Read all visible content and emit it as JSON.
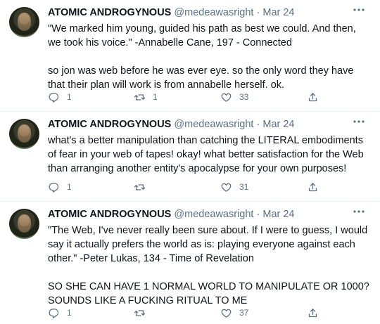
{
  "tweets": [
    {
      "name": "ATOMIC ANDROGYNOUS",
      "handle": "@medeawasright",
      "separator": "·",
      "date": "Mar 24",
      "text": "\"We marked him young, guided his path as best we could. And then, we took his voice.\" -Annabelle Cane, 197 - Connected\n\nso jon was web before he was ever eye. so the only word they have that their plan will work is from annabelle herself. ok.",
      "reply_count": "1",
      "retweet_count": "1",
      "like_count": "33"
    },
    {
      "name": "ATOMIC ANDROGYNOUS",
      "handle": "@medeawasright",
      "separator": "·",
      "date": "Mar 24",
      "text": "what's a better manipulation than catching the LITERAL embodiments of fear in your web of tapes! okay! what better satisfaction for the Web than arranging another entity's apocalypse for your own purposes!",
      "reply_count": "1",
      "retweet_count": "",
      "like_count": "31"
    },
    {
      "name": "ATOMIC ANDROGYNOUS",
      "handle": "@medeawasright",
      "separator": "·",
      "date": "Mar 24",
      "text": "\"The Web, I've never really been sure about. If I were to guess, I would say it actually prefers the world as is: playing everyone against each other.\" -Peter Lukas, 134 - Time of Revelation\n\nSO SHE CAN HAVE 1 NORMAL WORLD TO MANIPULATE OR 1000? SOUNDS LIKE A FUCKING RITUAL TO ME",
      "reply_count": "1",
      "retweet_count": "",
      "like_count": "37"
    }
  ],
  "icons": {
    "reply": "reply-icon",
    "retweet": "retweet-icon",
    "like": "heart-icon",
    "share": "share-icon",
    "more": "more-icon"
  },
  "colors": {
    "text": "#0f1419",
    "muted": "#5b7083",
    "divider": "#e6ecf0"
  }
}
